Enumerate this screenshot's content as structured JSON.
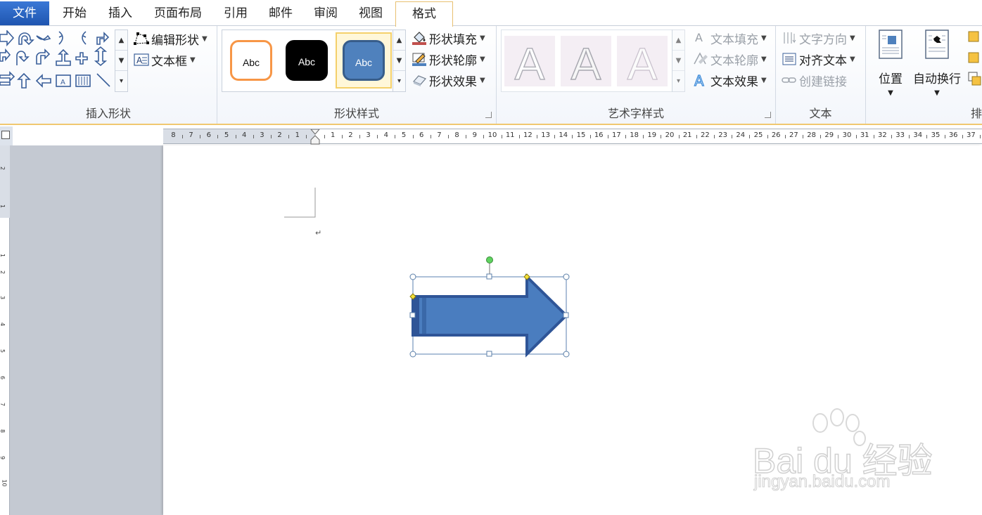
{
  "tabs": {
    "file": "文件",
    "items": [
      "开始",
      "插入",
      "页面布局",
      "引用",
      "邮件",
      "审阅",
      "视图"
    ],
    "active": "格式"
  },
  "groups": {
    "insert_shapes": {
      "label": "插入形状",
      "edit_shape": "编辑形状",
      "text_box": "文本框"
    },
    "shape_styles": {
      "label": "形状样式",
      "gallery": [
        "Abc",
        "Abc",
        "Abc"
      ],
      "fill": "形状填充",
      "outline": "形状轮廓",
      "effects": "形状效果"
    },
    "wordart": {
      "label": "艺术字样式",
      "letters": [
        "A",
        "A",
        "A"
      ],
      "text_fill": "文本填充",
      "text_outline": "文本轮廓",
      "text_effects": "文本效果"
    },
    "text": {
      "label": "文本",
      "direction": "文字方向",
      "align": "对齐文本",
      "link": "创建链接"
    },
    "arrange": {
      "label": "排",
      "position": "位置",
      "wrap": "自动换行"
    }
  },
  "ruler": {
    "left_numbers": [
      "8",
      "7",
      "6",
      "5",
      "4",
      "3",
      "2",
      "1"
    ],
    "right_numbers": [
      "1",
      "2",
      "3",
      "4",
      "5",
      "6",
      "7",
      "8",
      "9",
      "10",
      "11",
      "12",
      "13",
      "14",
      "15",
      "16",
      "17",
      "18",
      "19",
      "20",
      "21",
      "22",
      "23",
      "24",
      "25",
      "26",
      "27",
      "28",
      "29",
      "30",
      "31",
      "32",
      "33",
      "34",
      "35",
      "36",
      "37"
    ],
    "vertical_numbers": [
      "2",
      "1",
      "1",
      "2",
      "3",
      "4",
      "5",
      "6",
      "7",
      "8",
      "9",
      "10"
    ]
  },
  "document": {
    "paragraph_mark": "↵"
  },
  "colors": {
    "accent": "#4f81bd",
    "arrow_fill": "#4a7dbf",
    "arrow_outline": "#2f5597",
    "ribbon_border": "#f0c870"
  },
  "watermark": {
    "brand": "Bai du 经验",
    "url": "jingyan.baidu.com"
  }
}
